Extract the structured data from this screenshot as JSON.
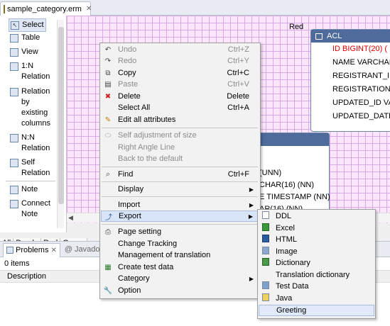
{
  "editor": {
    "tab_title": "sample_category.erm"
  },
  "palette": {
    "items": [
      {
        "label": "Select"
      },
      {
        "label": "Table"
      },
      {
        "label": "View"
      },
      {
        "label": "1:N Relation"
      },
      {
        "label": "Relation by existing columns"
      },
      {
        "label": "N:N Relation"
      },
      {
        "label": "Self Relation"
      },
      {
        "label": "Note"
      },
      {
        "label": "Connect Note"
      }
    ],
    "tabs": [
      "All",
      "Purple",
      "Red",
      "Green"
    ]
  },
  "canvas": {
    "category_label": "Red",
    "acl_table": {
      "name": "ACL",
      "columns": [
        {
          "text": "ID BIGINT(20) (",
          "pk": true
        },
        {
          "text": "NAME VARCHAR",
          "pk": false
        },
        {
          "text": "REGISTRANT_ID",
          "pk": false
        },
        {
          "text": "REGISTRATION_",
          "pk": false
        },
        {
          "text": "UPDATED_ID VA",
          "pk": false
        },
        {
          "text": "UPDATED_DATE",
          "pk": false
        }
      ]
    },
    "second_table": {
      "columns": [
        "(UNN)",
        "CHAR(16) (NN)",
        "E TIMESTAMP (NN)",
        "AR(16) (NN)"
      ]
    }
  },
  "bottom": {
    "tabs": [
      {
        "label": "Problems"
      },
      {
        "label": "Javadoc"
      }
    ],
    "items_count": "0 items",
    "column_header": "Description"
  },
  "context_menu": {
    "items": [
      {
        "label": "Undo",
        "shortcut": "Ctrl+Z",
        "disabled": true
      },
      {
        "label": "Redo",
        "shortcut": "Ctrl+Y",
        "disabled": true
      },
      {
        "label": "Copy",
        "shortcut": "Ctrl+C",
        "disabled": false
      },
      {
        "label": "Paste",
        "shortcut": "Ctrl+V",
        "disabled": true
      },
      {
        "label": "Delete",
        "shortcut": "Delete",
        "disabled": false
      },
      {
        "label": "Select All",
        "shortcut": "Ctrl+A",
        "disabled": false
      },
      {
        "label": "Edit all attributes",
        "shortcut": "",
        "disabled": false
      },
      {
        "label": "Self adjustment of size",
        "shortcut": "",
        "disabled": true
      },
      {
        "label": "Right Angle Line",
        "shortcut": "",
        "disabled": true
      },
      {
        "label": "Back to the default",
        "shortcut": "",
        "disabled": true
      },
      {
        "label": "Find",
        "shortcut": "Ctrl+F",
        "disabled": false
      },
      {
        "label": "Display",
        "shortcut": "",
        "disabled": false
      },
      {
        "label": "Import",
        "shortcut": "",
        "disabled": false
      },
      {
        "label": "Export",
        "shortcut": "",
        "disabled": false
      },
      {
        "label": "Page setting",
        "shortcut": "",
        "disabled": false
      },
      {
        "label": "Change Tracking",
        "shortcut": "",
        "disabled": false
      },
      {
        "label": "Management of translation",
        "shortcut": "",
        "disabled": false
      },
      {
        "label": "Create test data",
        "shortcut": "",
        "disabled": false
      },
      {
        "label": "Category",
        "shortcut": "",
        "disabled": false
      },
      {
        "label": "Option",
        "shortcut": "",
        "disabled": false
      }
    ]
  },
  "export_submenu": {
    "items": [
      {
        "label": "DDL"
      },
      {
        "label": "Excel"
      },
      {
        "label": "HTML"
      },
      {
        "label": "Image"
      },
      {
        "label": "Dictionary"
      },
      {
        "label": "Translation dictionary"
      },
      {
        "label": "Test Data"
      },
      {
        "label": "Java"
      },
      {
        "label": "Greeting"
      }
    ]
  }
}
